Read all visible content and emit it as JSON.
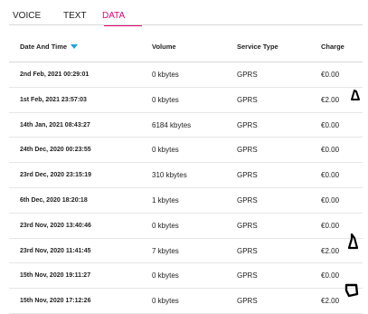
{
  "tabs": [
    {
      "label": "VOICE",
      "active": false
    },
    {
      "label": "TEXT",
      "active": false
    },
    {
      "label": "DATA",
      "active": true
    }
  ],
  "table": {
    "headers": {
      "date": "Date And Time",
      "volume": "Volume",
      "service_type": "Service Type",
      "charge": "Charge"
    },
    "rows": [
      {
        "date": "2nd Feb, 2021 00:29:01",
        "volume": "0 kbytes",
        "type": "GPRS",
        "charge": "€0.00"
      },
      {
        "date": "1st Feb, 2021 23:57:03",
        "volume": "0 kbytes",
        "type": "GPRS",
        "charge": "€2.00"
      },
      {
        "date": "14th Jan, 2021 08:43:27",
        "volume": "6184 kbytes",
        "type": "GPRS",
        "charge": "€0.00"
      },
      {
        "date": "24th Dec, 2020 00:23:55",
        "volume": "0 kbytes",
        "type": "GPRS",
        "charge": "€0.00"
      },
      {
        "date": "23rd Dec, 2020 23:15:19",
        "volume": "310 kbytes",
        "type": "GPRS",
        "charge": "€0.00"
      },
      {
        "date": "6th Dec, 2020 18:20:18",
        "volume": "1 kbytes",
        "type": "GPRS",
        "charge": "€0.00"
      },
      {
        "date": "23rd Nov, 2020 13:40:46",
        "volume": "0 kbytes",
        "type": "GPRS",
        "charge": "€0.00"
      },
      {
        "date": "23rd Nov, 2020 11:41:45",
        "volume": "7 kbytes",
        "type": "GPRS",
        "charge": "€2.00"
      },
      {
        "date": "15th Nov, 2020 19:11:27",
        "volume": "0 kbytes",
        "type": "GPRS",
        "charge": "€0.00"
      },
      {
        "date": "15th Nov, 2020 17:12:26",
        "volume": "0 kbytes",
        "type": "GPRS",
        "charge": "€2.00"
      }
    ]
  },
  "colors": {
    "accent": "#e20074",
    "sort_icon": "#1ea1e0"
  }
}
